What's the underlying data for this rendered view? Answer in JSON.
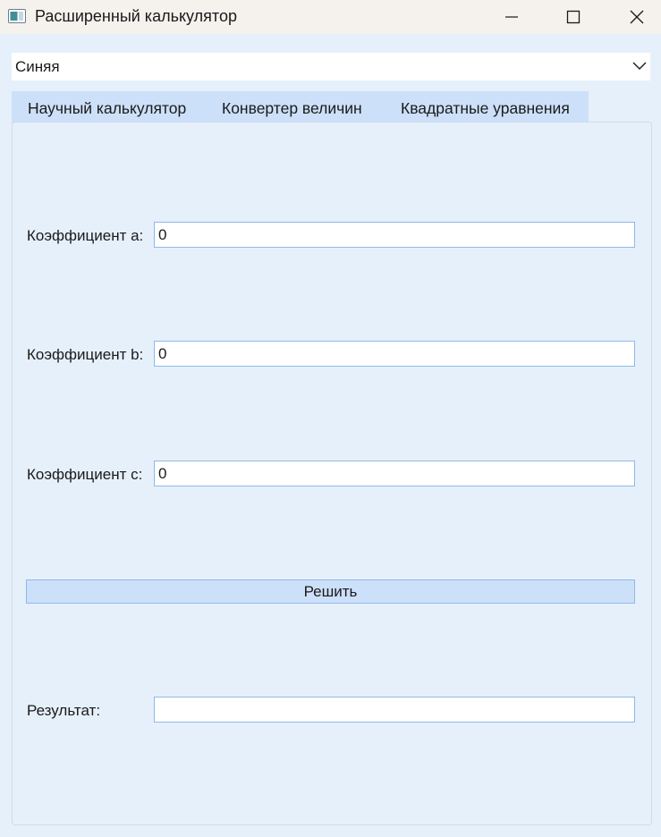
{
  "window": {
    "title": "Расширенный калькулятор",
    "icon": "app-window-icon"
  },
  "theme_select": {
    "value": "Синяя",
    "icon": "chevron-down-icon"
  },
  "tabs": [
    {
      "label": "Научный калькулятор",
      "selected": false
    },
    {
      "label": "Конвертер величин",
      "selected": false
    },
    {
      "label": "Квадратные уравнения",
      "selected": true
    }
  ],
  "form": {
    "coef_a": {
      "label": "Коэффициент a:",
      "value": "0"
    },
    "coef_b": {
      "label": "Коэффициент b:",
      "value": "0"
    },
    "coef_c": {
      "label": "Коэффициент c:",
      "value": "0"
    },
    "solve_label": "Решить",
    "result": {
      "label": "Результат:",
      "value": ""
    }
  },
  "colors": {
    "background": "#e6f0fb",
    "tab_strip": "#cde0f9",
    "field_border": "#8fb8e8",
    "titlebar": "#f5f2ee"
  }
}
